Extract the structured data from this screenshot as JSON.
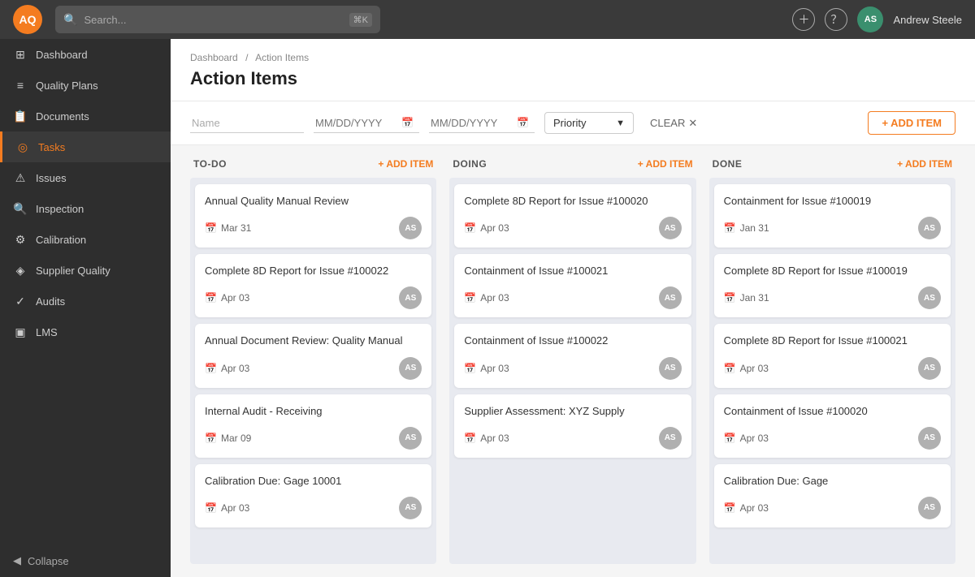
{
  "app": {
    "logo": "AQ",
    "user_initials": "AS",
    "user_name": "Andrew Steele",
    "search_placeholder": "Search...",
    "search_kbd": "⌘K"
  },
  "sidebar": {
    "items": [
      {
        "id": "dashboard",
        "label": "Dashboard",
        "icon": "⊞"
      },
      {
        "id": "quality-plans",
        "label": "Quality Plans",
        "icon": "≡"
      },
      {
        "id": "documents",
        "label": "Documents",
        "icon": "📄"
      },
      {
        "id": "tasks",
        "label": "Tasks",
        "icon": "◎",
        "active": true
      },
      {
        "id": "issues",
        "label": "Issues",
        "icon": "⚠"
      },
      {
        "id": "inspection",
        "label": "Inspection",
        "icon": "🔍"
      },
      {
        "id": "calibration",
        "label": "Calibration",
        "icon": "⚙"
      },
      {
        "id": "supplier-quality",
        "label": "Supplier Quality",
        "icon": "◈"
      },
      {
        "id": "audits",
        "label": "Audits",
        "icon": "✓"
      },
      {
        "id": "lms",
        "label": "LMS",
        "icon": "▣"
      }
    ],
    "collapse_label": "Collapse"
  },
  "breadcrumb": {
    "parts": [
      "Dashboard",
      "Action Items"
    ]
  },
  "page": {
    "title": "Action Items"
  },
  "filters": {
    "name_placeholder": "Name",
    "date_placeholder1": "MM/DD/YYYY",
    "date_placeholder2": "MM/DD/YYYY",
    "priority_label": "Priority",
    "clear_label": "CLEAR",
    "add_item_label": "+ ADD ITEM"
  },
  "columns": [
    {
      "id": "todo",
      "title": "TO-DO",
      "add_label": "+ ADD ITEM",
      "cards": [
        {
          "title": "Annual Quality Manual Review",
          "date": "Mar 31",
          "avatar": "AS"
        },
        {
          "title": "Complete 8D Report for Issue #100022",
          "date": "Apr 03",
          "avatar": "AS"
        },
        {
          "title": "Annual Document Review: Quality Manual",
          "date": "Apr 03",
          "avatar": "AS"
        },
        {
          "title": "Internal Audit - Receiving",
          "date": "Mar 09",
          "avatar": "AS"
        },
        {
          "title": "Calibration Due: Gage 10001",
          "date": "Apr 03",
          "avatar": "AS"
        }
      ]
    },
    {
      "id": "doing",
      "title": "DOING",
      "add_label": "+ ADD ITEM",
      "cards": [
        {
          "title": "Complete 8D Report for Issue #100020",
          "date": "Apr 03",
          "avatar": "AS"
        },
        {
          "title": "Containment of Issue #100021",
          "date": "Apr 03",
          "avatar": "AS"
        },
        {
          "title": "Containment of Issue #100022",
          "date": "Apr 03",
          "avatar": "AS"
        },
        {
          "title": "Supplier Assessment: XYZ Supply",
          "date": "Apr 03",
          "avatar": "AS"
        }
      ]
    },
    {
      "id": "done",
      "title": "DONE",
      "add_label": "+ ADD ITEM",
      "cards": [
        {
          "title": "Containment for Issue #100019",
          "date": "Jan 31",
          "avatar": "AS"
        },
        {
          "title": "Complete 8D Report for Issue #100019",
          "date": "Jan 31",
          "avatar": "AS"
        },
        {
          "title": "Complete 8D Report for Issue #100021",
          "date": "Apr 03",
          "avatar": "AS"
        },
        {
          "title": "Containment of Issue #100020",
          "date": "Apr 03",
          "avatar": "AS"
        },
        {
          "title": "Calibration Due: Gage",
          "date": "Apr 03",
          "avatar": "AS"
        }
      ]
    }
  ]
}
